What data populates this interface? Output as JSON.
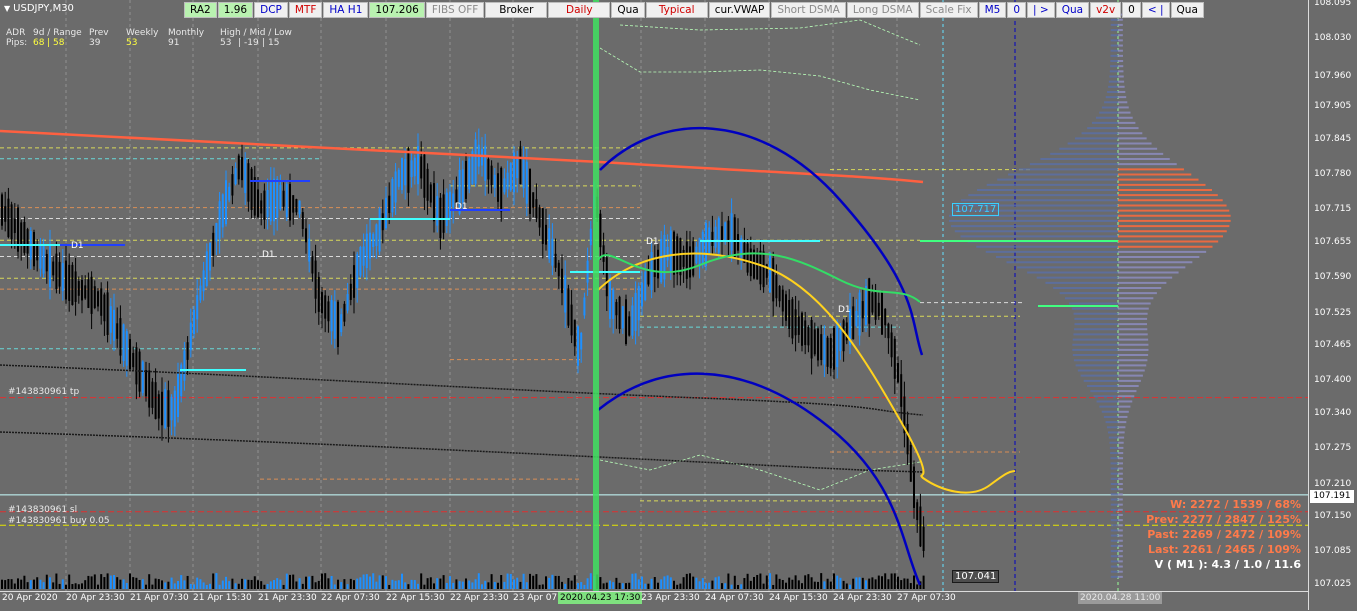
{
  "symbol": "USDJPY,M30",
  "toolbar": [
    {
      "label": "RA2",
      "style": "green"
    },
    {
      "label": "1.96",
      "style": "green"
    },
    {
      "label": "DCP",
      "style": ""
    },
    {
      "label": "MTF",
      "style": "red"
    },
    {
      "label": "HA H1",
      "style": ""
    },
    {
      "label": "107.206",
      "style": "green"
    },
    {
      "label": "FIBS OFF",
      "style": "grayt"
    },
    {
      "label": "Broker",
      "style": "blackt wide"
    },
    {
      "label": "Daily",
      "style": "red wide"
    },
    {
      "label": "Qua",
      "style": "blackt"
    },
    {
      "label": "Typical",
      "style": "red wide"
    },
    {
      "label": "cur.VWAP",
      "style": "blackt"
    },
    {
      "label": "Short DSMA",
      "style": "grayt"
    },
    {
      "label": "Long DSMA",
      "style": "grayt"
    },
    {
      "label": "Scale Fix",
      "style": "grayt"
    },
    {
      "label": "M5",
      "style": ""
    },
    {
      "label": "0",
      "style": ""
    },
    {
      "label": "| >",
      "style": ""
    },
    {
      "label": "Qua",
      "style": ""
    },
    {
      "label": "v2v",
      "style": "red"
    },
    {
      "label": "0",
      "style": "blackt"
    },
    {
      "label": "< |",
      "style": ""
    },
    {
      "label": "Qua",
      "style": "blackt"
    }
  ],
  "adr": {
    "headers": [
      "ADR",
      "9d / Range",
      "Prev",
      "Weekly",
      "Monthly",
      "High / Mid / Low"
    ],
    "row_label": "Pips:",
    "values": [
      "68",
      "58",
      "39",
      "53",
      "91",
      "53",
      "-19",
      "15"
    ]
  },
  "trade_labels": {
    "tp": "#143830961 tp",
    "sl": "#143830961 sl",
    "buy": "#143830961 buy 0.05"
  },
  "stats": [
    {
      "text": "W: 2272 / 1539 / 68%",
      "color": "o"
    },
    {
      "text": "Prev: 2277 / 2847 / 125%",
      "color": "o"
    },
    {
      "text": "Past: 2269 / 2472 / 109%",
      "color": "o"
    },
    {
      "text": "Last: 2261 / 2465 / 109%",
      "color": "o"
    },
    {
      "text": "V ( M1 ): 4.3 / 1.0 / 11.6",
      "color": "w"
    }
  ],
  "marker_labels": {
    "d1": "D1",
    "level_upper": "107.717",
    "level_lower": "107.041"
  },
  "current_price": "107.191",
  "time_highlight": [
    {
      "text": "2020.04.23 17:30"
    },
    {
      "text": "2020.04.28 11:00"
    }
  ],
  "colors": {
    "bull": "#1e90ff",
    "bear": "#000000",
    "ma_red": "#ff6040",
    "arc_blue": "#0000c0",
    "vwap_yellow": "#ffd21e",
    "ma_green": "#33dd66",
    "grid": "#c8c8c8"
  },
  "chart_data": {
    "type": "candlestick",
    "symbol": "USDJPY",
    "timeframe": "M30",
    "price_ticks": [
      "108.095",
      "108.030",
      "107.960",
      "107.905",
      "107.845",
      "107.780",
      "107.715",
      "107.655",
      "107.590",
      "107.525",
      "107.465",
      "107.400",
      "107.340",
      "107.275",
      "107.210",
      "107.150",
      "107.085",
      "107.025"
    ],
    "time_ticks": [
      "20 Apr 2020",
      "20 Apr 23:30",
      "21 Apr 07:30",
      "21 Apr 15:30",
      "21 Apr 23:30",
      "22 Apr 07:30",
      "22 Apr 15:30",
      "22 Apr 23:30",
      "23 Apr 07",
      "2020.04.23 17:30",
      "23 Apr 23:30",
      "24 Apr 07:30",
      "24 Apr 15:30",
      "24 Apr 23:30",
      "27 Apr 07:30",
      "2020.04.28 11:00"
    ],
    "ylim": [
      107.025,
      108.095
    ],
    "current_price": 107.191,
    "levels": [
      107.717,
      107.041,
      107.37,
      107.16
    ],
    "trend": [
      [
        0,
        107.72
      ],
      [
        40,
        107.63
      ],
      [
        70,
        107.58
      ],
      [
        100,
        107.55
      ],
      [
        130,
        107.45
      ],
      [
        160,
        107.35
      ],
      [
        175,
        107.35
      ],
      [
        200,
        107.56
      ],
      [
        220,
        107.7
      ],
      [
        240,
        107.8
      ],
      [
        260,
        107.72
      ],
      [
        280,
        107.74
      ],
      [
        300,
        107.72
      ],
      [
        320,
        107.55
      ],
      [
        340,
        107.5
      ],
      [
        360,
        107.62
      ],
      [
        380,
        107.68
      ],
      [
        400,
        107.78
      ],
      [
        420,
        107.8
      ],
      [
        440,
        107.7
      ],
      [
        460,
        107.75
      ],
      [
        480,
        107.82
      ],
      [
        500,
        107.75
      ],
      [
        520,
        107.8
      ],
      [
        540,
        107.7
      ],
      [
        560,
        107.6
      ],
      [
        580,
        107.45
      ],
      [
        595,
        107.75
      ],
      [
        610,
        107.55
      ],
      [
        630,
        107.5
      ],
      [
        650,
        107.6
      ],
      [
        670,
        107.64
      ],
      [
        690,
        107.62
      ],
      [
        710,
        107.66
      ],
      [
        730,
        107.68
      ],
      [
        750,
        107.62
      ],
      [
        770,
        107.6
      ],
      [
        790,
        107.52
      ],
      [
        810,
        107.48
      ],
      [
        830,
        107.45
      ],
      [
        850,
        107.5
      ],
      [
        870,
        107.55
      ],
      [
        885,
        107.52
      ],
      [
        900,
        107.4
      ],
      [
        910,
        107.26
      ],
      [
        918,
        107.15
      ],
      [
        925,
        107.1
      ]
    ]
  }
}
